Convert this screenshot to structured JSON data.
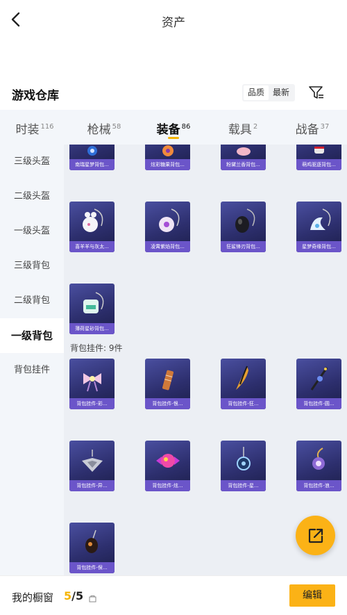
{
  "header": {
    "title": "资产",
    "back_icon": "chevron-left-icon"
  },
  "section": {
    "title": "游戏仓库",
    "sort_options": [
      "品质",
      "最新"
    ],
    "filter_icon": "filter-icon"
  },
  "tabs": [
    {
      "label": "时装",
      "count": "116"
    },
    {
      "label": "枪械",
      "count": "58"
    },
    {
      "label": "装备",
      "count": "86"
    },
    {
      "label": "载具",
      "count": "2"
    },
    {
      "label": "战备",
      "count": "37"
    }
  ],
  "sidebar": [
    "三级头盔",
    "二级头盔",
    "一级头盔",
    "三级背包",
    "二级背包",
    "一级背包",
    "背包挂件"
  ],
  "items_top": [
    "南瑞星梦背包...",
    "炫彩糖果背包...",
    "粉黛兰香背包...",
    "萌鸡驱逐背包..."
  ],
  "items_backpack": [
    "喜羊羊与灰太...",
    "凌霄紫焰背包...",
    "狂鲨锋刃背包...",
    "星梦奇缘背包...",
    "薄荷星砂背包..."
  ],
  "group_label": "背包挂件: 9件",
  "items_charms": [
    "背包挂件-彩...",
    "背包挂件-恨...",
    "背包挂件-狂...",
    "背包挂件-圆...",
    "背包挂件-异...",
    "背包挂件-炫...",
    "背包挂件-星...",
    "背包挂件-浪...",
    "背包挂件-保..."
  ],
  "bottom": {
    "label": "我的橱窗",
    "count_used": "5",
    "count_sep": "/",
    "count_total": "5",
    "edit_label": "编辑"
  },
  "colors": {
    "accent": "#fbb216",
    "card_caption": "#6b55c9",
    "card_bg": "#2d2f6e"
  }
}
